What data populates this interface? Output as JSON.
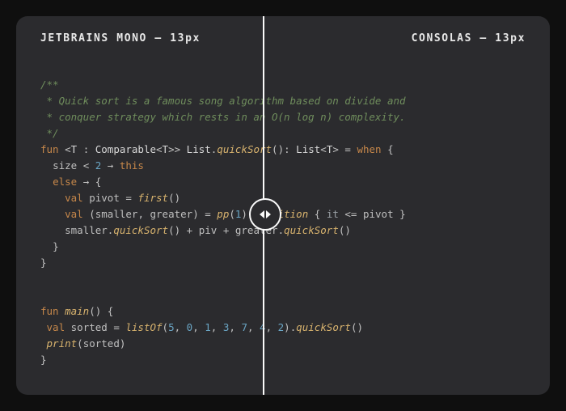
{
  "header": {
    "left": "JETBRAINS MONO – 13px",
    "right": "CONSOLAS – 13px"
  },
  "comment": {
    "open": "/**",
    "l1": " * Quick sort is a famous song algorithm based on divide and",
    "l2": " * conquer strategy which rests in an O(n log n) complexity.",
    "close": " */"
  },
  "code": {
    "fun": "fun",
    "lt": "<",
    "T": "T",
    "colon": " : ",
    "Comparable": "Comparable",
    "gt": ">",
    "double_gt": ">>",
    "sp": " ",
    "List": "List",
    "dot": ".",
    "quickSort": "quickSort",
    "parens": "()",
    "ret_colon": ": ",
    "eq": " = ",
    "when": "when",
    "obrace": " {",
    "cbrace": "}",
    "size": "size",
    "lt2": " < ",
    "two": "2",
    "arrow": " → ",
    "this": "this",
    "else": "else",
    "val": "val",
    "pivot": "pivot",
    "eq2": " = ",
    "first": "first",
    "open_destruct": " (",
    "smaller": "smaller",
    "comma": ", ",
    "greater": "greater",
    "close_destruct": ")",
    "pp": "pp",
    "one": "1",
    "partition": "partition",
    "it": "it",
    "lteq": " <= ",
    "plus": " + ",
    "piv_plus": "piv ",
    "main": "main",
    "sorted": "sorted",
    "listOf": "listOf",
    "args_open": "(",
    "args_close": ")",
    "n5": "5",
    "n0": "0",
    "n1": "1",
    "n3": "3",
    "n7": "7",
    "n4": "4",
    "n2": "2",
    "print": "print"
  }
}
